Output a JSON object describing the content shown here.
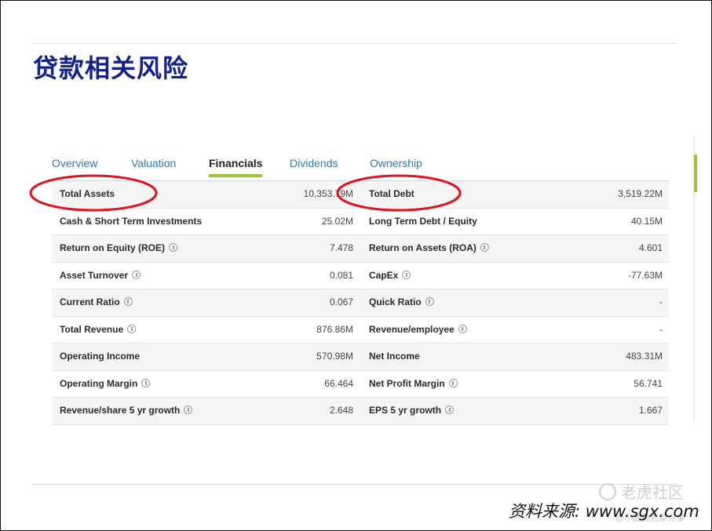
{
  "page": {
    "title": "贷款相关风险"
  },
  "tabs": [
    "Overview",
    "Valuation",
    "Financials",
    "Dividends",
    "Ownership"
  ],
  "active_tab": "Financials",
  "accent_color": "#9dc43b",
  "tab_color": "#3776b4",
  "annotation_color": "#e0141e",
  "rows": [
    {
      "l_label": "Total Assets",
      "l_value": "10,353.79M",
      "r_label": "Total Debt",
      "r_value": "3,519.22M"
    },
    {
      "l_label": "Cash & Short Term Investments",
      "l_value": "25.02M",
      "r_label": "Long Term Debt / Equity",
      "r_value": "40.15M"
    },
    {
      "l_label": "Return on Equity (ROE)",
      "l_value": "7.478",
      "r_label": "Return on Assets (ROA)",
      "r_value": "4.601"
    },
    {
      "l_label": "Asset Turnover",
      "l_value": "0.081",
      "r_label": "CapEx",
      "r_value": "-77.63M"
    },
    {
      "l_label": "Current Ratio",
      "l_value": "0.067",
      "r_label": "Quick Ratio",
      "r_value": "-"
    },
    {
      "l_label": "Total Revenue",
      "l_value": "876.86M",
      "r_label": "Revenue/employee",
      "r_value": "-"
    },
    {
      "l_label": "Operating Income",
      "l_value": "570.98M",
      "r_label": "Net Income",
      "r_value": "483.31M"
    },
    {
      "l_label": "Operating Margin",
      "l_value": "66.464",
      "r_label": "Net Profit Margin",
      "r_value": "56.741"
    },
    {
      "l_label": "Revenue/share 5 yr growth",
      "l_value": "2.648",
      "r_label": "EPS 5 yr growth",
      "r_value": "1.667"
    }
  ],
  "footer": {
    "source": "资料来源: www.sgx.com"
  },
  "watermark": {
    "text": "老虎社区",
    "sub": "@小散投资那点事"
  }
}
